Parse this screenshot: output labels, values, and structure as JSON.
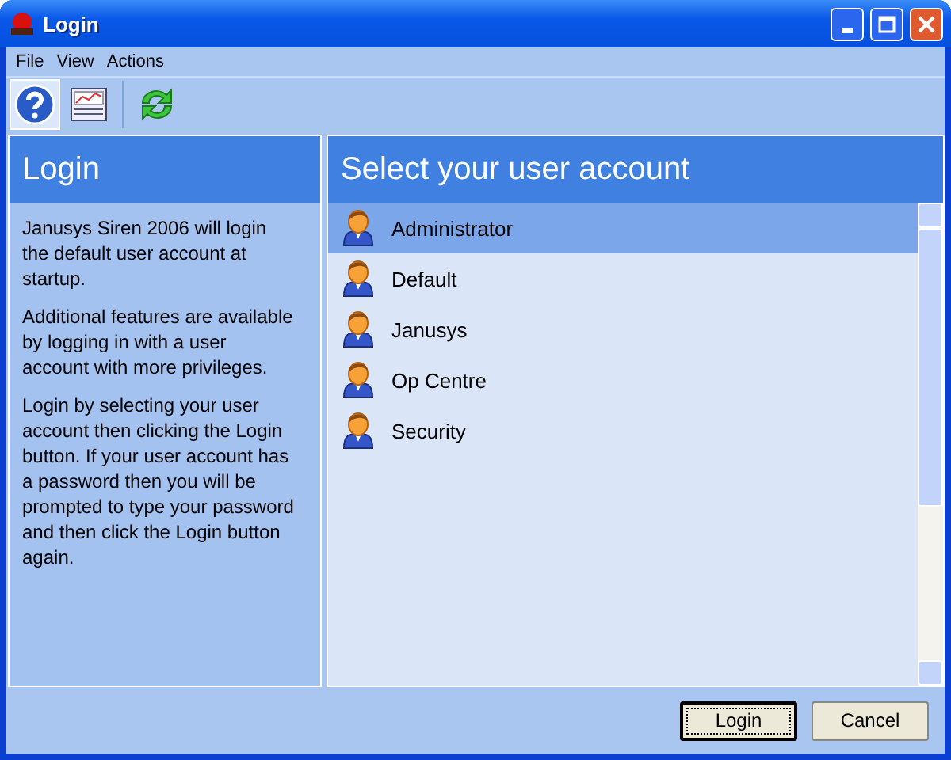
{
  "window": {
    "title": "Login"
  },
  "menu": [
    "File",
    "View",
    "Actions"
  ],
  "toolbar": [
    {
      "kind": "help",
      "selected": true
    },
    {
      "kind": "chart",
      "selected": false
    },
    {
      "kind": "refresh",
      "selected": false
    }
  ],
  "info_panel": {
    "title": "Login",
    "paragraphs": [
      "Janusys Siren 2006 will login the default user account at startup.",
      "Additional features are available by logging in with a user account with more privileges.",
      "Login by selecting your user account then clicking the Login button. If your user account has a password then you will be prompted to type your password and then click the Login button again."
    ]
  },
  "accounts_panel": {
    "title": "Select your user account",
    "accounts": [
      {
        "name": "Administrator",
        "selected": true
      },
      {
        "name": "Default",
        "selected": false
      },
      {
        "name": "Janusys",
        "selected": false
      },
      {
        "name": "Op Centre",
        "selected": false
      },
      {
        "name": "Security",
        "selected": false
      }
    ]
  },
  "buttons": [
    {
      "label": "Login",
      "default": true
    },
    {
      "label": "Cancel",
      "default": false
    }
  ]
}
